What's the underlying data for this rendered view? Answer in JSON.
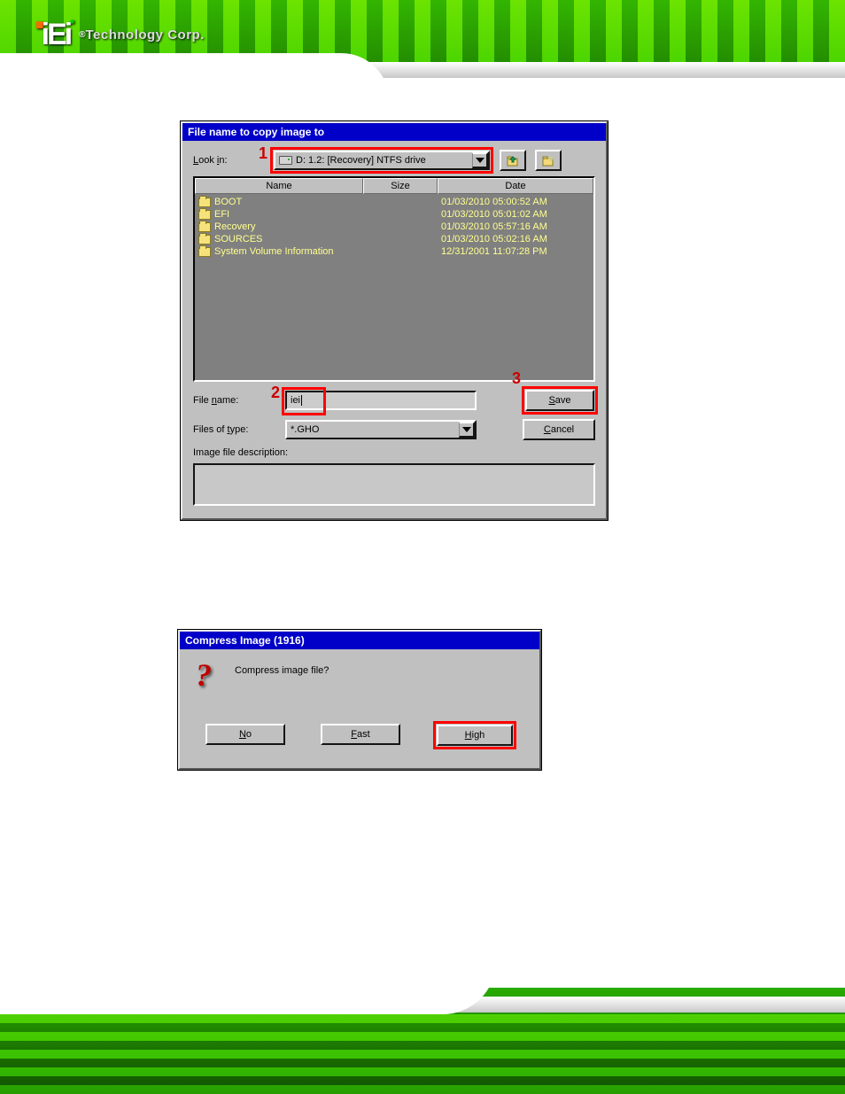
{
  "logo": {
    "brand": "iEi",
    "reg": "®",
    "text": "Technology Corp."
  },
  "dialog1": {
    "title": "File name to copy image to",
    "look_in_label": "Look in:",
    "look_in_value": "D: 1.2: [Recovery] NTFS drive",
    "cols": {
      "name": "Name",
      "size": "Size",
      "date": "Date"
    },
    "rows": [
      {
        "name": "BOOT",
        "size": "",
        "date": "01/03/2010 05:00:52 AM"
      },
      {
        "name": "EFI",
        "size": "",
        "date": "01/03/2010 05:01:02 AM"
      },
      {
        "name": "Recovery",
        "size": "",
        "date": "01/03/2010 05:57:16 AM"
      },
      {
        "name": "SOURCES",
        "size": "",
        "date": "01/03/2010 05:02:16 AM"
      },
      {
        "name": "System Volume Information",
        "size": "",
        "date": "12/31/2001 11:07:28 PM"
      }
    ],
    "file_name_label": "File name:",
    "file_name_value": "iei",
    "files_of_type_label": "Files of type:",
    "files_of_type_value": "*.GHO",
    "image_desc_label": "Image file description:",
    "save": "Save",
    "cancel": "Cancel",
    "callouts": {
      "c1": "1",
      "c2": "2",
      "c3": "3"
    }
  },
  "dialog2": {
    "title": "Compress Image (1916)",
    "message": "Compress image file?",
    "no": "No",
    "fast": "Fast",
    "high": "High"
  }
}
